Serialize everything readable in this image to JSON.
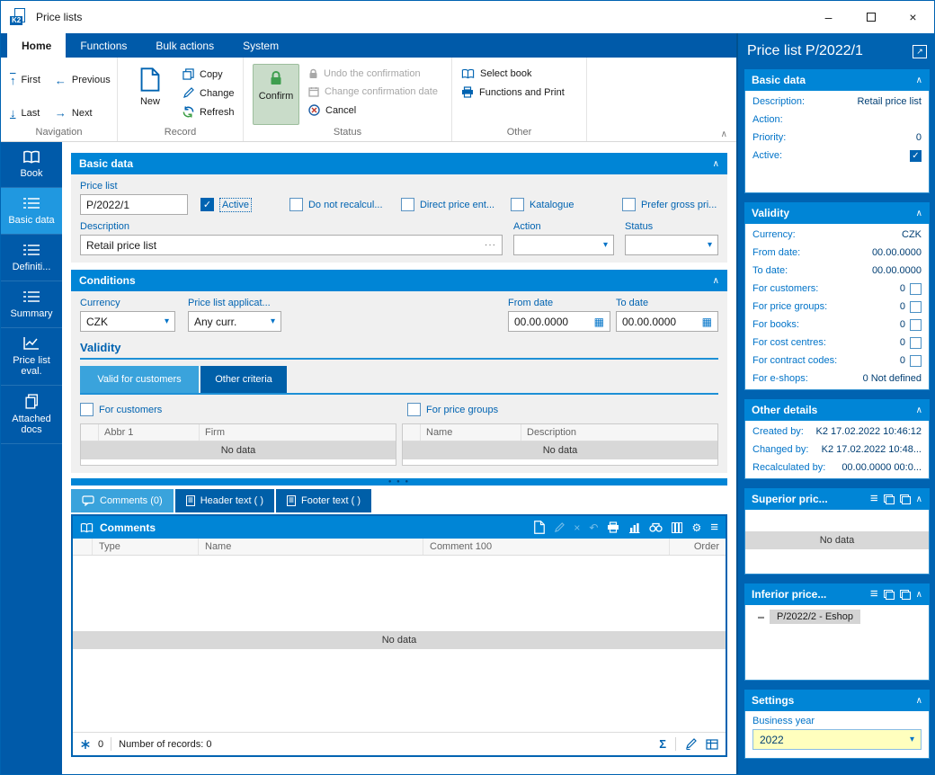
{
  "window": {
    "title": "Price lists"
  },
  "icons": {
    "minimize": "–",
    "close": "×",
    "chevron_up": "∧",
    "dropdown_arrow": "▾",
    "menu": "≡",
    "sigma": "Σ",
    "ellipsis": "···",
    "handle_dots": "●  ●  ●",
    "arrow_up": "↑",
    "arrow_down": "↓",
    "arrow_left": "←",
    "arrow_right": "→",
    "gear": "⚙",
    "calendar": "▦",
    "check": "✓",
    "external_link": "↗",
    "tree_dash": "▬",
    "faded_cross": "×",
    "faded_undo": "↶"
  },
  "ribbon": {
    "tabs": {
      "home": "Home",
      "functions": "Functions",
      "bulk": "Bulk actions",
      "system": "System"
    },
    "navigation": {
      "label": "Navigation",
      "first": "First",
      "previous": "Previous",
      "last": "Last",
      "next": "Next"
    },
    "record": {
      "label": "Record",
      "new": "New",
      "copy": "Copy",
      "change": "Change",
      "refresh": "Refresh"
    },
    "status": {
      "label": "Status",
      "confirm": "Confirm",
      "undo": "Undo the confirmation",
      "change_date": "Change confirmation date",
      "cancel": "Cancel"
    },
    "other": {
      "label": "Other",
      "select_book": "Select book",
      "functions_print": "Functions and Print"
    }
  },
  "sidebar": {
    "items": [
      {
        "label": "Book"
      },
      {
        "label": "Basic data"
      },
      {
        "label": "Definiti..."
      },
      {
        "label": "Summary"
      },
      {
        "label": "Price list eval."
      },
      {
        "label": "Attached docs"
      }
    ]
  },
  "basic_data": {
    "title": "Basic data",
    "price_list_label": "Price list",
    "price_list_value": "P/2022/1",
    "active_label": "Active",
    "cb_recalc": "Do not recalcul...",
    "cb_direct": "Direct price ent...",
    "cb_katalogue": "Katalogue",
    "cb_gross": "Prefer gross pri...",
    "description_label": "Description",
    "description_value": "Retail price list",
    "action_label": "Action",
    "status_label": "Status"
  },
  "conditions": {
    "title": "Conditions",
    "currency_label": "Currency",
    "currency_value": "CZK",
    "applicability_label": "Price list applicat...",
    "applicability_value": "Any curr.",
    "from_date_label": "From date",
    "from_date_value": "00.00.0000",
    "to_date_label": "To date",
    "to_date_value": "00.00.0000",
    "validity_title": "Validity",
    "tab_customers": "Valid for customers",
    "tab_other": "Other criteria",
    "for_customers": "For customers",
    "for_price_groups": "For price groups",
    "customers_cols": [
      "Abbr 1",
      "Firm"
    ],
    "groups_cols": [
      "Name",
      "Description"
    ],
    "no_data": "No data"
  },
  "tabs_bottom": {
    "comments": "Comments (0)",
    "header_text": "Header text ( )",
    "footer_text": "Footer text ( )"
  },
  "comments": {
    "title": "Comments",
    "col_type": "Type",
    "col_name": "Name",
    "col_comment": "Comment 100",
    "col_order": "Order",
    "no_data": "No data",
    "count": "0",
    "records": "Number of records: 0"
  },
  "details": {
    "title": "Price list P/2022/1",
    "basic": {
      "title": "Basic data",
      "rows": [
        {
          "label": "Description:",
          "value": "Retail price list"
        },
        {
          "label": "Action:",
          "value": ""
        },
        {
          "label": "Priority:",
          "value": "0"
        },
        {
          "label": "Active:",
          "value": ""
        }
      ]
    },
    "validity": {
      "title": "Validity",
      "rows": [
        {
          "label": "Currency:",
          "value": "CZK"
        },
        {
          "label": "From date:",
          "value": "00.00.0000"
        },
        {
          "label": "To date:",
          "value": "00.00.0000"
        },
        {
          "label": "For customers:",
          "value": "0"
        },
        {
          "label": "For price groups:",
          "value": "0"
        },
        {
          "label": "For books:",
          "value": "0"
        },
        {
          "label": "For cost centres:",
          "value": "0"
        },
        {
          "label": "For contract codes:",
          "value": "0"
        },
        {
          "label": "For e-shops:",
          "value": "0 Not defined"
        }
      ]
    },
    "other": {
      "title": "Other details",
      "rows": [
        {
          "label": "Created by:",
          "value": "K2 17.02.2022 10:46:12"
        },
        {
          "label": "Changed by:",
          "value": "K2 17.02.2022 10:48..."
        },
        {
          "label": "Recalculated by:",
          "value": "00.00.0000 00:0..."
        }
      ]
    },
    "superior": {
      "title": "Superior pric...",
      "no_data": "No data"
    },
    "inferior": {
      "title": "Inferior price...",
      "item": "P/2022/2 - Eshop"
    },
    "settings": {
      "title": "Settings",
      "business_year_label": "Business year",
      "business_year_value": "2022"
    }
  }
}
